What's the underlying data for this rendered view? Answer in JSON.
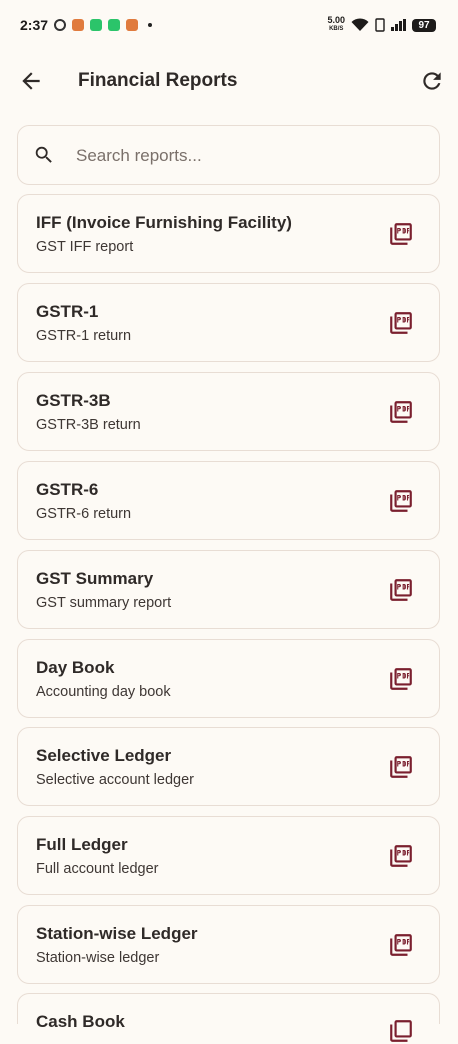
{
  "status_bar": {
    "time": "2:37",
    "speed_value": "5.00",
    "speed_unit": "KB/S",
    "battery": "97"
  },
  "app_bar": {
    "title": "Financial Reports"
  },
  "search": {
    "placeholder": "Search reports..."
  },
  "reports": [
    {
      "title": "IFF (Invoice Furnishing Facility)",
      "subtitle": "GST IFF report"
    },
    {
      "title": "GSTR-1",
      "subtitle": "GSTR-1 return"
    },
    {
      "title": "GSTR-3B",
      "subtitle": "GSTR-3B return"
    },
    {
      "title": "GSTR-6",
      "subtitle": "GSTR-6 return"
    },
    {
      "title": "GST Summary",
      "subtitle": "GST summary report"
    },
    {
      "title": "Day Book",
      "subtitle": "Accounting day book"
    },
    {
      "title": "Selective Ledger",
      "subtitle": "Selective account ledger"
    },
    {
      "title": "Full Ledger",
      "subtitle": "Full account ledger"
    },
    {
      "title": "Station-wise Ledger",
      "subtitle": "Station-wise ledger"
    },
    {
      "title": "Cash Book",
      "subtitle": ""
    }
  ],
  "colors": {
    "background": "#fdfaf5",
    "card_border": "#e8ddd4",
    "pdf_icon": "#7a1f2e",
    "text": "#2f2a28"
  }
}
